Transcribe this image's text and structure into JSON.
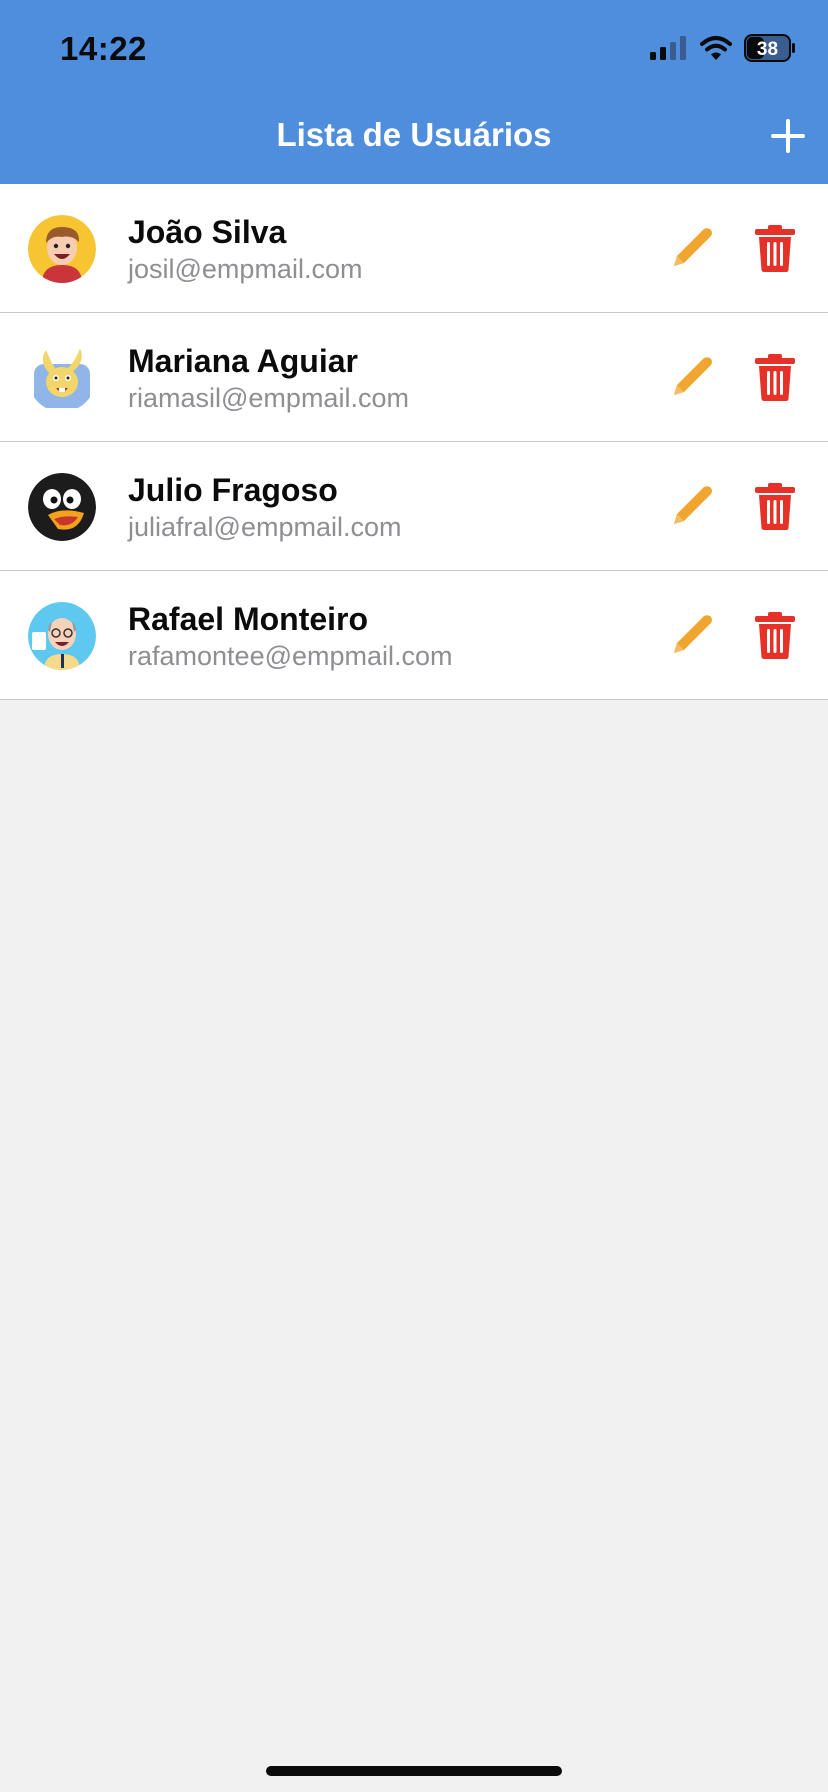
{
  "status_bar": {
    "time": "14:22",
    "battery": "38"
  },
  "header": {
    "title": "Lista de Usuários",
    "add_icon": "plus-icon"
  },
  "users": [
    {
      "name": "João Silva",
      "email": "josil@empmail.com",
      "avatar": "cartoon-boy-avatar"
    },
    {
      "name": "Mariana Aguiar",
      "email": "riamasil@empmail.com",
      "avatar": "cartoon-rabbit-avatar"
    },
    {
      "name": "Julio Fragoso",
      "email": "juliafral@empmail.com",
      "avatar": "cartoon-penguin-avatar"
    },
    {
      "name": "Rafael Monteiro",
      "email": "rafamontee@empmail.com",
      "avatar": "cartoon-man-avatar"
    }
  ],
  "colors": {
    "header_bg": "#4f8ddd",
    "edit_icon": "#f0a530",
    "delete_icon": "#e53128",
    "email_text": "#8e8e93",
    "background": "#f1f1f1"
  }
}
